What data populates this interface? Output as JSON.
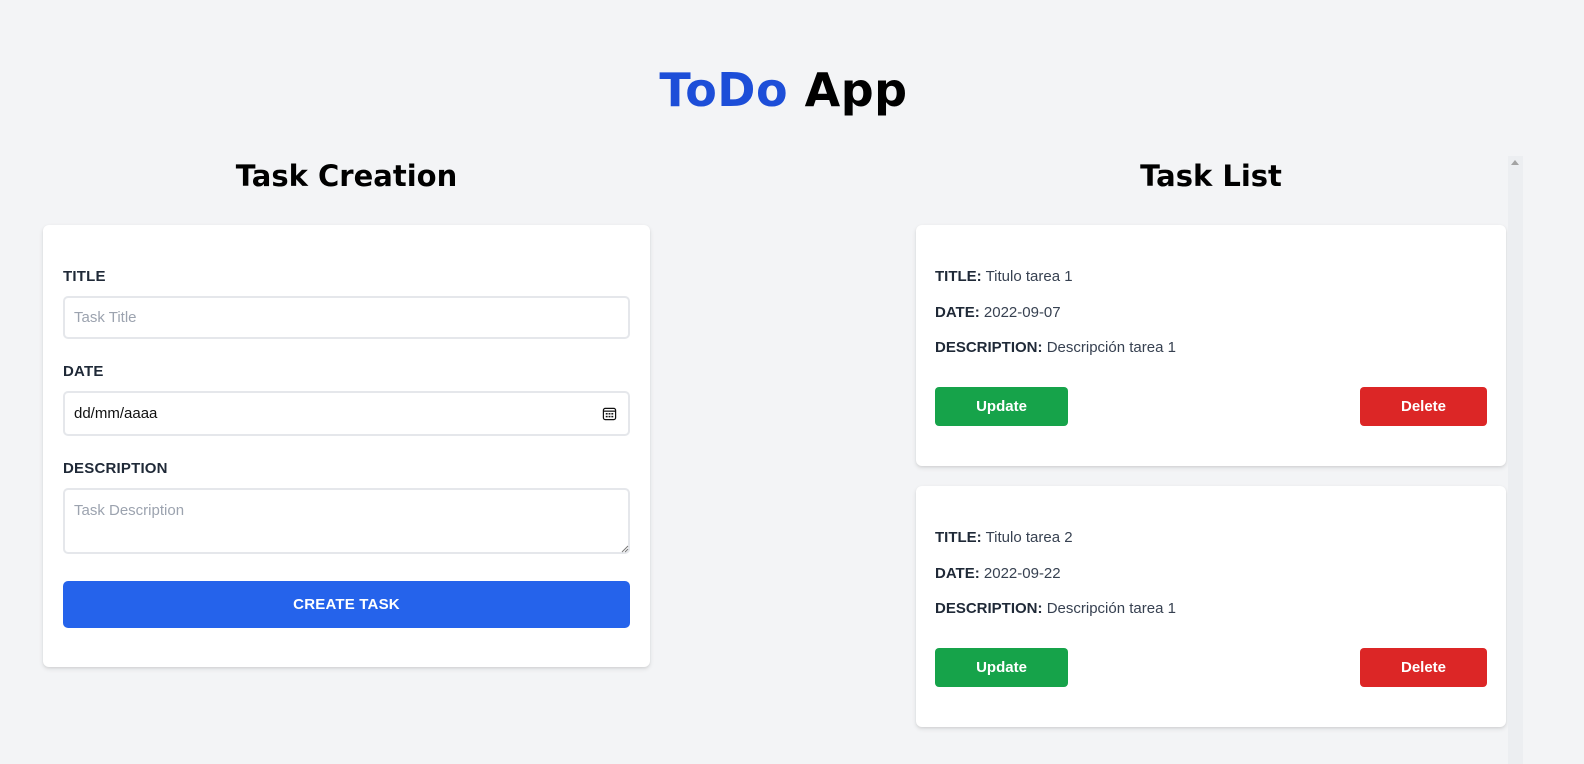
{
  "app": {
    "title_accent": "ToDo",
    "title_rest": "App",
    "accent_color": "#1d4ed8"
  },
  "creation": {
    "heading": "Task Creation",
    "title_label": "TITLE",
    "title_placeholder": "Task Title",
    "date_label": "DATE",
    "date_value": "dd/mm/aaaa",
    "description_label": "DESCRIPTION",
    "description_placeholder": "Task Description",
    "create_button": "CREATE TASK",
    "button_color": "#2563eb"
  },
  "list": {
    "heading": "Task List",
    "labels": {
      "title": "TITLE:",
      "date": "DATE:",
      "description": "DESCRIPTION:"
    },
    "tasks": [
      {
        "title": "Titulo tarea 1",
        "date": "2022-09-07",
        "description": "Descripción tarea 1",
        "update_label": "Update",
        "delete_label": "Delete"
      },
      {
        "title": "Titulo tarea 2",
        "date": "2022-09-22",
        "description": "Descripción tarea 1",
        "update_label": "Update",
        "delete_label": "Delete"
      }
    ],
    "update_color": "#16a34a",
    "delete_color": "#dc2626"
  },
  "icons": {
    "date_picker": "calendar-icon",
    "scroll_up": "chevron-up-icon"
  }
}
